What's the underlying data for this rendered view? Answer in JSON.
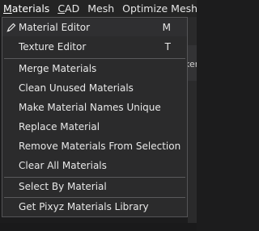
{
  "menubar": {
    "items": [
      {
        "label": "Materials",
        "mnemonic": "M",
        "rest": "aterials"
      },
      {
        "label": "CAD",
        "mnemonic": "C",
        "rest": "AD"
      },
      {
        "label": "Mesh",
        "mnemonic": "",
        "rest": "Mesh"
      },
      {
        "label": "Optimize Mesh",
        "mnemonic": "",
        "rest": "Optimize Mesh"
      }
    ]
  },
  "background": {
    "partial_text": "ker"
  },
  "menu": {
    "items": [
      {
        "label": "Material Editor",
        "shortcut": "M",
        "checked": true,
        "icon": "pencil-check-icon"
      },
      {
        "label": "Texture Editor",
        "shortcut": "T"
      },
      {
        "label": "Merge Materials"
      },
      {
        "label": "Clean Unused Materials"
      },
      {
        "label": "Make Material Names Unique"
      },
      {
        "label": "Replace Material"
      },
      {
        "label": "Remove Materials From Selection"
      },
      {
        "label": "Clear All Materials"
      },
      {
        "label": "Select By Material"
      },
      {
        "label": "Get Pixyz Materials Library"
      }
    ]
  },
  "colors": {
    "menu_bg": "#2b2b2c",
    "menu_border": "#545456",
    "text": "#e8e8e8",
    "separator": "#5a5a5c"
  }
}
